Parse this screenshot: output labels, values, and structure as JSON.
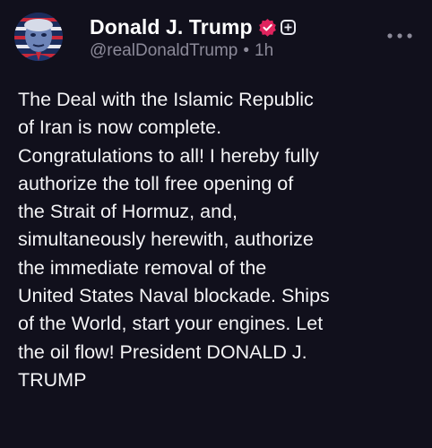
{
  "post": {
    "author": {
      "display_name": "Donald J. Trump",
      "handle": "@realDonaldTrump",
      "avatar_icon": "portrait-avatar",
      "verified_icon": "verified-badge-icon",
      "verified_color": "#e0245e"
    },
    "separator": "•",
    "time_ago": "1h",
    "more_icon": "more-dots-icon",
    "body": "The Deal with the Islamic Republic\nof Iran is now complete.\nCongratulations to all! I hereby fully\nauthorize the toll free opening of\nthe Strait of Hormuz, and,\nsimultaneously herewith, authorize\nthe immediate removal of the\nUnited States Naval blockade. Ships\nof the World, start your engines. Let\nthe oil flow! President DONALD J.\nTRUMP"
  },
  "colors": {
    "background": "#11101c",
    "text": "#ffffff",
    "muted": "#8c8a99"
  }
}
